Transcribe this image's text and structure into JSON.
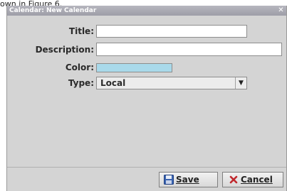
{
  "caption": "own in Figure 6.",
  "window": {
    "title": "Calendar: New Calendar",
    "close_glyph": "✕"
  },
  "form": {
    "title_label": "Title:",
    "title_value": "",
    "description_label": "Description:",
    "description_value": "",
    "color_label": "Color:",
    "color_value": "#a9d9ea",
    "type_label": "Type:",
    "type_value": "Local",
    "type_arrow": "▼"
  },
  "buttons": {
    "save_label": "Save",
    "save_icon": "floppy-disk-icon",
    "cancel_label": "Cancel",
    "cancel_icon": "cancel-x-icon"
  }
}
